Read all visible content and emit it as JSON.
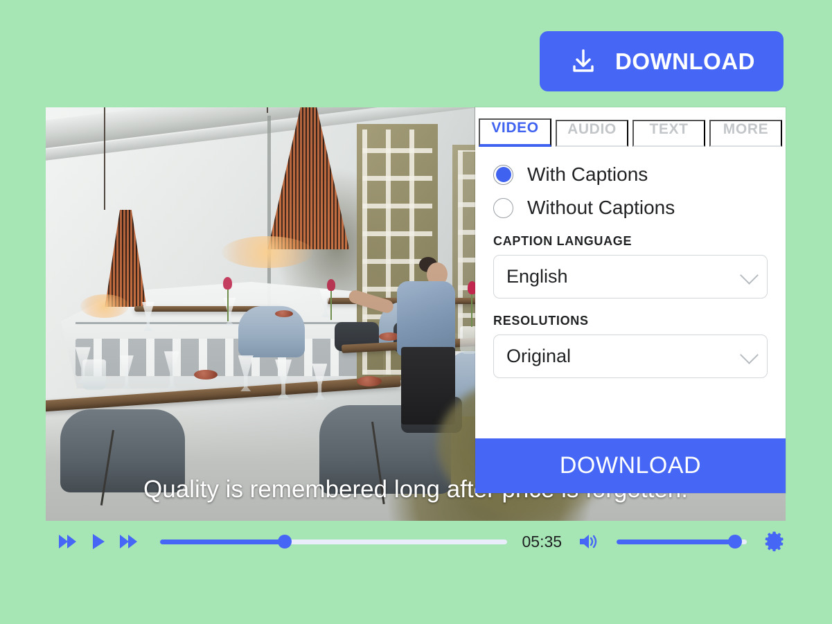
{
  "theme": {
    "background": "#a6e5b4",
    "accent_blue": "#4666f5",
    "tab_active_blue": "#3f62f0",
    "tab_inactive_grey": "#c3c6c9",
    "panel_background": "#ffffff"
  },
  "top_download": {
    "label": "DOWNLOAD",
    "icon": "download-icon"
  },
  "video": {
    "caption": "Quality is remembered long after price is forgotten.",
    "scene_description": "Restaurant interior with pendant lamps, blue chairs, set tables and a waitress by the window"
  },
  "panel": {
    "tabs": [
      {
        "label": "VIDEO",
        "active": true
      },
      {
        "label": "AUDIO",
        "active": false
      },
      {
        "label": "TEXT",
        "active": false
      },
      {
        "label": "MORE",
        "active": false
      }
    ],
    "caption_options": [
      {
        "label": "With Captions",
        "selected": true
      },
      {
        "label": "Without Captions",
        "selected": false
      }
    ],
    "fields": [
      {
        "label": "CAPTION LANGUAGE",
        "value": "English",
        "icon": "chevron-down-icon"
      },
      {
        "label": "RESOLUTIONS",
        "value": "Original",
        "icon": "chevron-down-icon"
      }
    ],
    "download_label": "DOWNLOAD"
  },
  "controls": {
    "rewind_icon": "rewind-icon",
    "play_icon": "play-icon",
    "forward_icon": "fast-forward-icon",
    "volume_icon": "volume-icon",
    "settings_icon": "gear-icon",
    "time": "05:35",
    "progress_percent": 36,
    "volume_percent": 91
  }
}
